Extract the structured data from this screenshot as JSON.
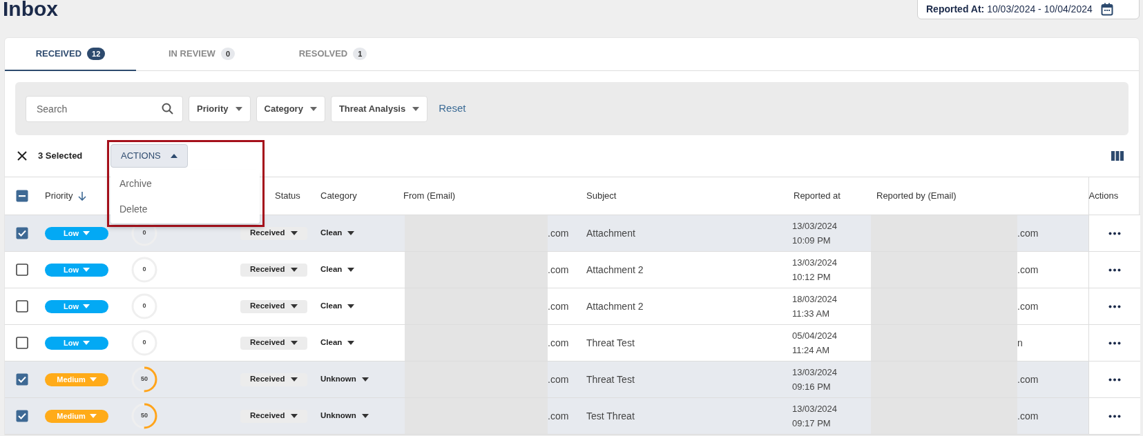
{
  "page_title": "Inbox",
  "date_range": {
    "text": "**Reported At:** 10/03/2024 - 10/04/2024"
  },
  "tabs": [
    {
      "label": "RECEIVED",
      "count": "12",
      "selected": true
    },
    {
      "label": "IN REVIEW",
      "count": "0",
      "selected": false
    },
    {
      "label": "RESOLVED",
      "count": "1",
      "selected": false
    }
  ],
  "filters": {
    "search": {
      "placeholder": "Search"
    },
    "dropdowns": [
      "Priority",
      "Category",
      "Threat Analysis"
    ],
    "reset": "Reset"
  },
  "selection": {
    "text": "3 Selected",
    "actions_button": {
      "label": "ACTIONS",
      "expanded": true
    },
    "menu": [
      "Archive",
      "Delete"
    ]
  },
  "table": {
    "header_checkbox": {
      "indeterminate": true
    },
    "columns": [
      {
        "label": "Priority",
        "sorted": true
      },
      {
        "label": "Status",
        "sorted": false
      },
      {
        "label": "Category",
        "sorted": false
      },
      {
        "label": "From (Email)",
        "sorted": false
      },
      {
        "label": "Subject",
        "sorted": false
      },
      {
        "label": "Reported at",
        "sorted": false
      },
      {
        "label": "Reported by (Email)",
        "sorted": false
      },
      {
        "label": "Actions",
        "sorted": false
      }
    ],
    "rows": [
      {
        "selected": true,
        "priority": {
          "label": "Low",
          "color": "#03a9f4"
        },
        "threat": {
          "score": "0",
          "level": 0
        },
        "status": "Received",
        "category": "Clean",
        "from": ".com",
        "subject": "Attachment",
        "date": "13/03/2024",
        "time": "10:09 PM",
        "reported_by": ".com"
      },
      {
        "selected": false,
        "priority": {
          "label": "Low",
          "color": "#03a9f4"
        },
        "threat": {
          "score": "0",
          "level": 0
        },
        "status": "Received",
        "category": "Clean",
        "from": ".com",
        "subject": "Attachment 2",
        "date": "13/03/2024",
        "time": "10:12 PM",
        "reported_by": ".com"
      },
      {
        "selected": false,
        "priority": {
          "label": "Low",
          "color": "#03a9f4"
        },
        "threat": {
          "score": "0",
          "level": 0
        },
        "status": "Received",
        "category": "Clean",
        "from": ".com",
        "subject": "Attachment 2",
        "date": "18/03/2024",
        "time": "11:33 AM",
        "reported_by": ".com"
      },
      {
        "selected": false,
        "priority": {
          "label": "Low",
          "color": "#03a9f4"
        },
        "threat": {
          "score": "0",
          "level": 0
        },
        "status": "Received",
        "category": "Clean",
        "from": ".com",
        "subject": "Threat Test",
        "date": "05/04/2024",
        "time": "11:24 AM",
        "reported_by": "n"
      },
      {
        "selected": true,
        "priority": {
          "label": "Medium",
          "color": "#ffab19"
        },
        "threat": {
          "score": "50",
          "level": 0.5
        },
        "status": "Received",
        "category": "Unknown",
        "from": ".com",
        "subject": "Threat Test",
        "date": "13/03/2024",
        "time": "09:16 PM",
        "reported_by": ".com"
      },
      {
        "selected": true,
        "priority": {
          "label": "Medium",
          "color": "#ffab19"
        },
        "threat": {
          "score": "50",
          "level": 0.5
        },
        "status": "Received",
        "category": "Unknown",
        "from": ".com",
        "subject": "Test Threat",
        "date": "13/03/2024",
        "time": "09:17 PM",
        "reported_by": ".com"
      }
    ]
  }
}
